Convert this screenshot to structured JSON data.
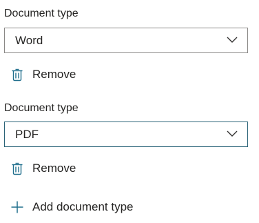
{
  "colors": {
    "accent": "#2a6378",
    "icon": "#1f6e8c",
    "text": "#252423",
    "border": "#8a8886"
  },
  "groups": [
    {
      "label": "Document type",
      "selected": "Word",
      "remove_label": "Remove",
      "icons": {
        "dropdown": "chevron-down-icon",
        "remove": "trash-icon"
      }
    },
    {
      "label": "Document type",
      "selected": "PDF",
      "remove_label": "Remove",
      "icons": {
        "dropdown": "chevron-down-icon",
        "remove": "trash-icon"
      }
    }
  ],
  "add_action": {
    "label": "Add document type",
    "icon": "plus-icon"
  }
}
